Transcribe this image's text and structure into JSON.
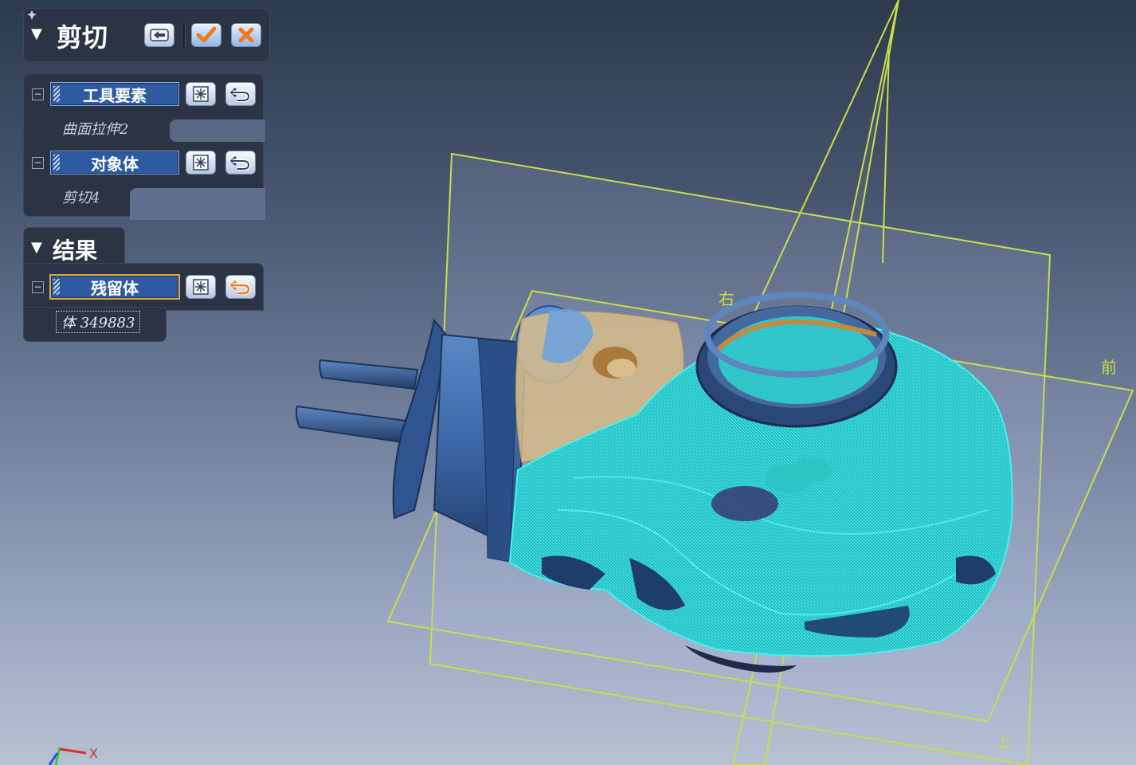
{
  "cut_panel": {
    "title": "剪切",
    "back_icon": "arrow-left-icon",
    "ok_icon": "checkmark-icon",
    "cancel_icon": "x-cancel-icon"
  },
  "tool_elements": {
    "label": "工具要素",
    "item": "曲面拉伸2"
  },
  "target_body": {
    "label": "对象体",
    "item": "剪切4"
  },
  "result_panel": {
    "title": "结果",
    "remain": {
      "label": "残留体",
      "item": "体 349883"
    }
  },
  "viewport": {
    "plane_labels": {
      "right": "右",
      "front": "前",
      "top": "上"
    },
    "axis_x": "X"
  },
  "colors": {
    "panel_bg": "#2b3444",
    "field_blue": "#2d5aa0",
    "active_border": "#e2a63c",
    "plane_outline": "#c9de47",
    "scan_blue": "#3f6fb0",
    "cut_cyan": "#27d4d4",
    "tan_region": "#d8bc8a"
  }
}
